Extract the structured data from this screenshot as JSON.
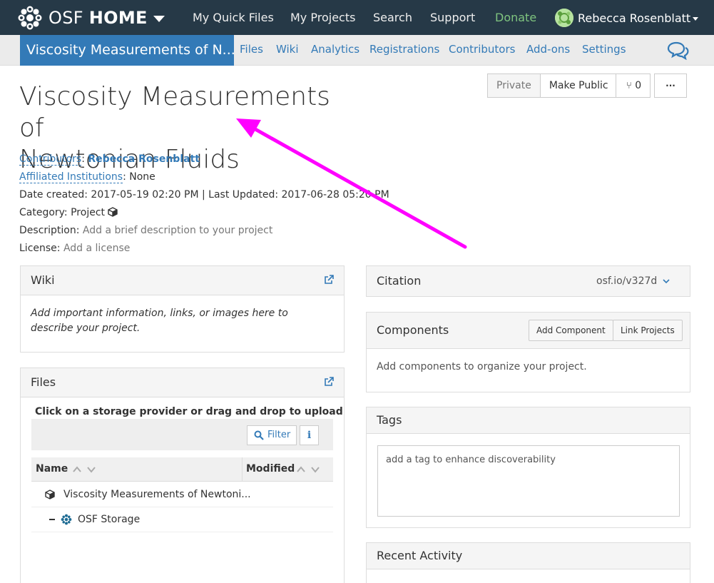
{
  "topbar": {
    "brand_light": "OSF",
    "brand_bold": "HOME",
    "nav": [
      "My Quick Files",
      "My Projects",
      "Search",
      "Support",
      "Donate"
    ],
    "user_name": "Rebecca Rosenblatt"
  },
  "subbar": {
    "project_tab": "Viscosity Measurements of N...",
    "items": [
      "Files",
      "Wiki",
      "Analytics",
      "Registrations",
      "Contributors",
      "Add-ons",
      "Settings"
    ]
  },
  "header": {
    "title_line1": "Viscosity Measurements of",
    "title_line2": "Newtonian Fluids",
    "btn_private": "Private",
    "btn_make_public": "Make Public",
    "fork_count": "0",
    "more": "···"
  },
  "meta": {
    "contributors_label": "Contributors",
    "contributors_value": "Rebecca Rosenblatt",
    "affiliated_label": "Affiliated Institutions",
    "affiliated_value": "None",
    "dates": "Date created: 2017-05-19 02:20 PM | Last Updated: 2017-06-28 05:20 PM",
    "category_label": "Category:",
    "category_value": "Project",
    "description_label": "Description:",
    "description_value": "Add a brief description to your project",
    "license_label": "License:",
    "license_value": "Add a license"
  },
  "wiki": {
    "title": "Wiki",
    "body": "Add important information, links, or images here to describe your project."
  },
  "files": {
    "title": "Files",
    "hint": "Click on a storage provider or drag and drop to upload",
    "filter_label": "Filter",
    "info_label": "i",
    "col_name": "Name",
    "col_modified": "Modified",
    "rows": [
      {
        "label": "Viscosity Measurements of Newtoni..."
      },
      {
        "label": "OSF Storage"
      }
    ]
  },
  "citation": {
    "title": "Citation",
    "link": "osf.io/v327d"
  },
  "components": {
    "title": "Components",
    "add_btn": "Add Component",
    "link_btn": "Link Projects",
    "body": "Add components to organize your project."
  },
  "tags": {
    "title": "Tags",
    "placeholder": "add a tag to enhance discoverability"
  },
  "recent": {
    "title": "Recent Activity"
  },
  "colors": {
    "navbar": "#263947",
    "accent": "#337ab7",
    "donate": "#7fc47f",
    "annotation_arrow": "#ff00ff"
  }
}
